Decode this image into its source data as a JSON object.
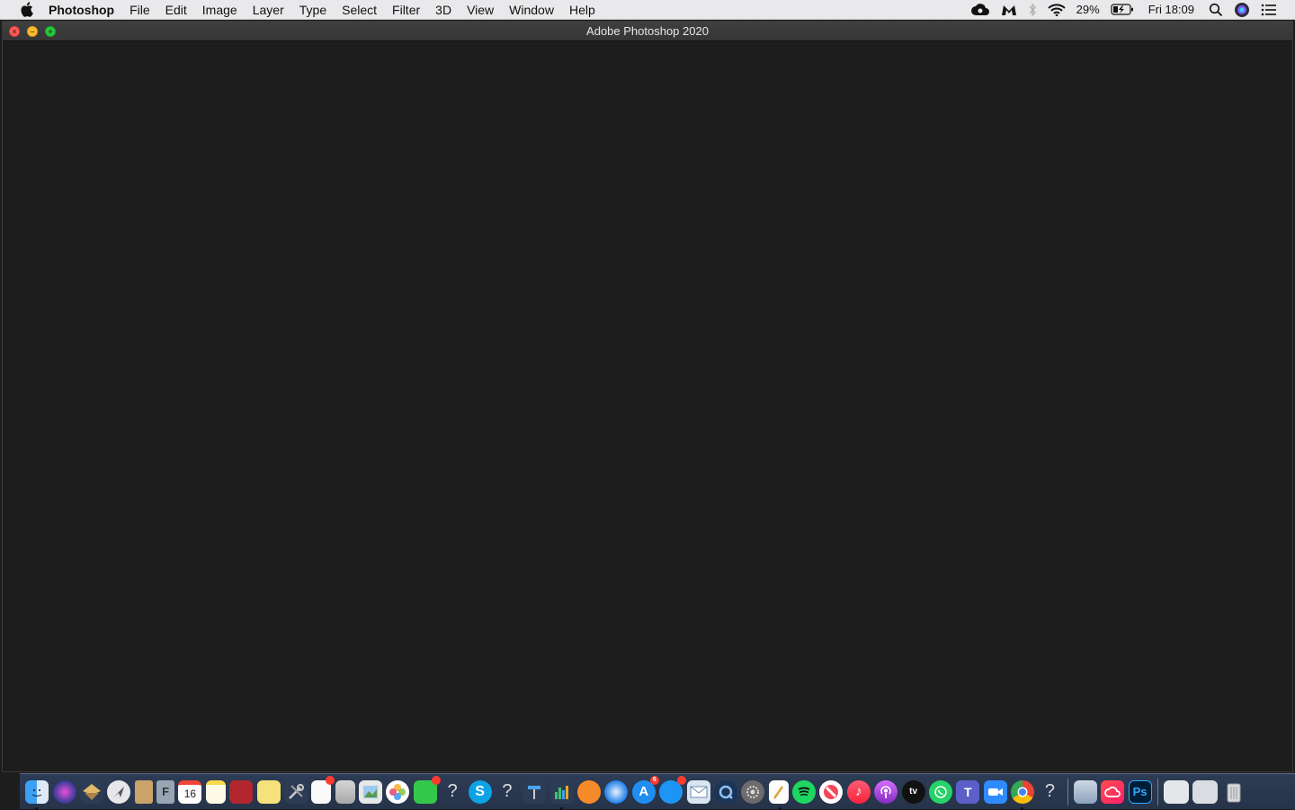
{
  "menubar": {
    "app_name": "Photoshop",
    "menus": [
      "File",
      "Edit",
      "Image",
      "Layer",
      "Type",
      "Select",
      "Filter",
      "3D",
      "View",
      "Window",
      "Help"
    ],
    "battery_percent": "29%",
    "clock": "Fri 18:09"
  },
  "window": {
    "title": "Adobe Photoshop 2020"
  },
  "dock": {
    "calendar_day": "16",
    "app_store_badge": "6",
    "photoshop_label": "Ps"
  }
}
